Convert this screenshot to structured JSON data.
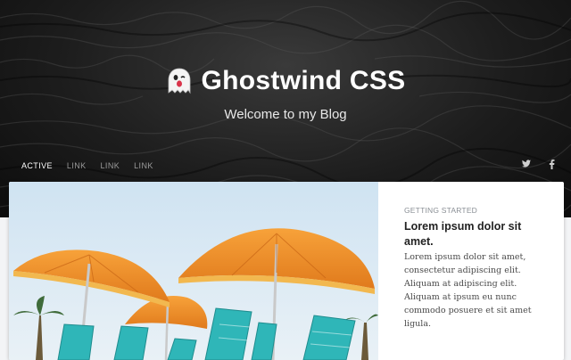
{
  "site": {
    "title": "Ghostwind CSS",
    "tagline": "Welcome to my Blog",
    "logo_icon": "ghost-icon"
  },
  "nav": {
    "items": [
      {
        "label": "ACTIVE",
        "active": true
      },
      {
        "label": "LINK",
        "active": false
      },
      {
        "label": "LINK",
        "active": false
      },
      {
        "label": "LINK",
        "active": false
      }
    ]
  },
  "social": {
    "twitter_glyph": "𝕥",
    "facebook_glyph": "f"
  },
  "featured_post": {
    "category": "GETTING STARTED",
    "title": "Lorem ipsum dolor sit amet.",
    "excerpt": "Lorem ipsum dolor sit amet, consectetur adipiscing elit. Aliquam at adipiscing elit. Aliquam at ipsum eu nunc commodo posuere et sit amet ligula.",
    "image_icon": "beach-umbrellas-photo"
  },
  "colors": {
    "hero_bg": "#1d1d1d",
    "page_bg": "#f3f4f6",
    "umbrella": "#f28c28",
    "chair": "#2fb6b8"
  }
}
